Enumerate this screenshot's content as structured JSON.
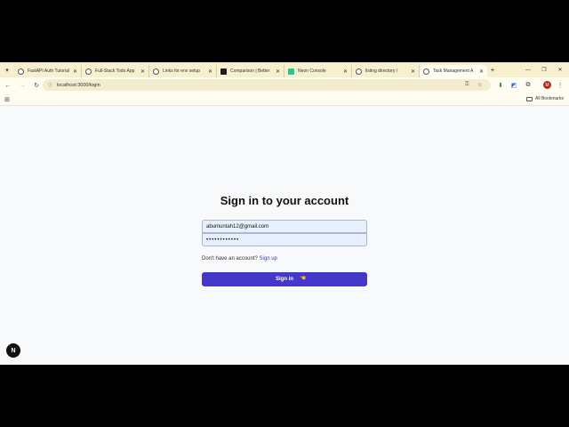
{
  "tabs": [
    {
      "label": "FastAPI Auth Tutorial",
      "icon": "globe-icon",
      "active": false
    },
    {
      "label": "Full-Stack Todo App",
      "icon": "globe-icon",
      "active": false
    },
    {
      "label": "Links for env setup",
      "icon": "globe-icon",
      "active": false
    },
    {
      "label": "Comparison | Better",
      "icon": "dark-square-icon",
      "active": false
    },
    {
      "label": "Neon Console",
      "icon": "neon-icon",
      "active": false
    },
    {
      "label": "listing directory /",
      "icon": "globe-icon",
      "active": false
    },
    {
      "label": "Task Management A",
      "icon": "globe-icon",
      "active": true
    }
  ],
  "address_bar": {
    "url": "localhost:3000/login"
  },
  "bookmarks": {
    "all_bookmarks_label": "All Bookmarks"
  },
  "profile": {
    "initial": "M"
  },
  "login": {
    "title": "Sign in to your account",
    "email_value": "abumuntah12@gmail.com",
    "password_value": "••••••••••••",
    "signup_prompt": "Don't have an account?",
    "signup_link": "Sign up",
    "signin_label": "Sign in"
  },
  "dev_badge": {
    "label": "N"
  },
  "colors": {
    "accent": "#4338ca",
    "link": "#3f3aa8",
    "input_bg": "#e8f0fe"
  }
}
